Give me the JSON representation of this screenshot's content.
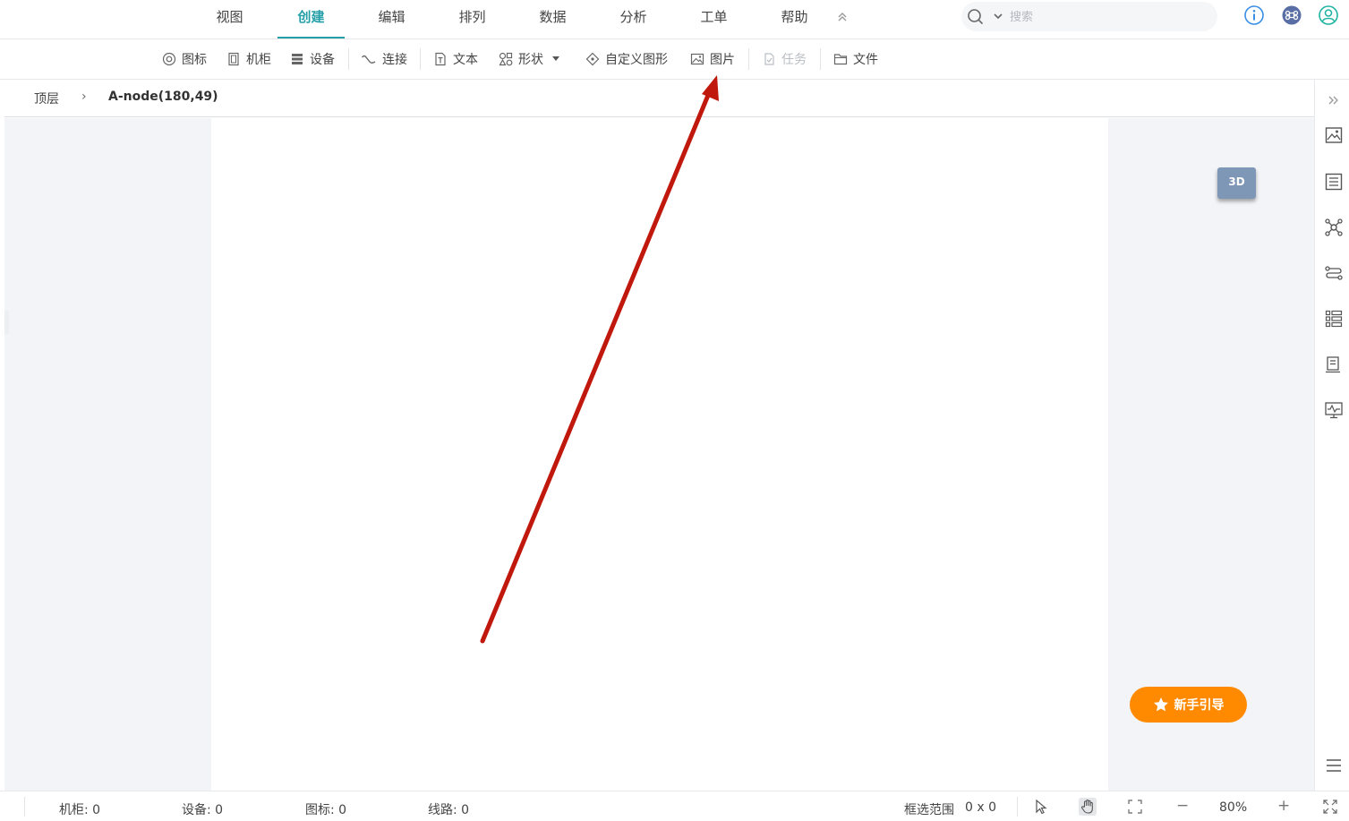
{
  "menu": {
    "tabs": [
      {
        "label": "视图"
      },
      {
        "label": "创建"
      },
      {
        "label": "编辑"
      },
      {
        "label": "排列"
      },
      {
        "label": "数据"
      },
      {
        "label": "分析"
      },
      {
        "label": "工单"
      },
      {
        "label": "帮助"
      }
    ],
    "active_tab": "创建",
    "search_placeholder": "搜索"
  },
  "toolbar": {
    "icon_label": "图标",
    "cabinet_label": "机柜",
    "device_label": "设备",
    "connect_label": "连接",
    "text_label": "文本",
    "shape_label": "形状",
    "custom_shape_label": "自定义图形",
    "image_label": "图片",
    "task_label": "任务",
    "file_label": "文件"
  },
  "breadcrumb": {
    "root": "顶层",
    "separator": "›",
    "current": "A-node(180,49)"
  },
  "canvas": {
    "btn_3d": "3D",
    "guide_label": "新手引导"
  },
  "status": {
    "cabinet": "机柜: 0",
    "device": "设备: 0",
    "icon": "图标: 0",
    "line": "线路: 0",
    "selection_label": "框选范围",
    "selection_value": "0 x 0",
    "zoom_minus": "−",
    "zoom": "80%",
    "zoom_plus": "+"
  },
  "colors": {
    "accent": "#26a0a8",
    "guide": "#ff8a00",
    "btn3d": "#7f97b6",
    "annotation_arrow": "#c0180c",
    "top_icon_blue": "#3a8ee6",
    "top_icon_green": "#20b3a4"
  }
}
